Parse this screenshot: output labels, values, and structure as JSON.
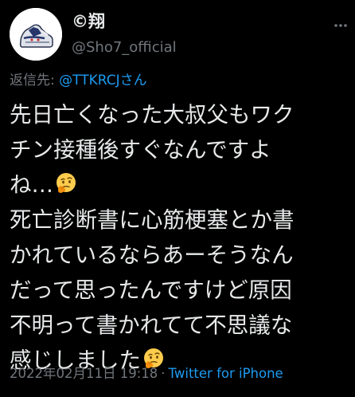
{
  "author": {
    "display_name": "©翔",
    "handle": "@Sho7_official",
    "avatar_icon": "sneaker-avatar"
  },
  "reply": {
    "prefix": "返信先: ",
    "mention": "@TTKRCJさん"
  },
  "tweet": {
    "lines": [
      "先日亡くなった大叔父もワク",
      "チン接種後すぐなんですよ",
      "ね…",
      "死亡診断書に心筋梗塞とか書",
      "かれているならあーそうなん",
      "だって思ったんですけど原因",
      "不明って書かれてて不思議な",
      "感じしました"
    ],
    "emoji_icon": "thinking-face-emoji"
  },
  "meta": {
    "timestamp": "2022年02月11日 19:18",
    "separator": "·",
    "source": "Twitter for iPhone"
  },
  "colors": {
    "background": "#000000",
    "text": "#e7e9ea",
    "muted": "#71767b",
    "link": "#1d9bf0"
  }
}
